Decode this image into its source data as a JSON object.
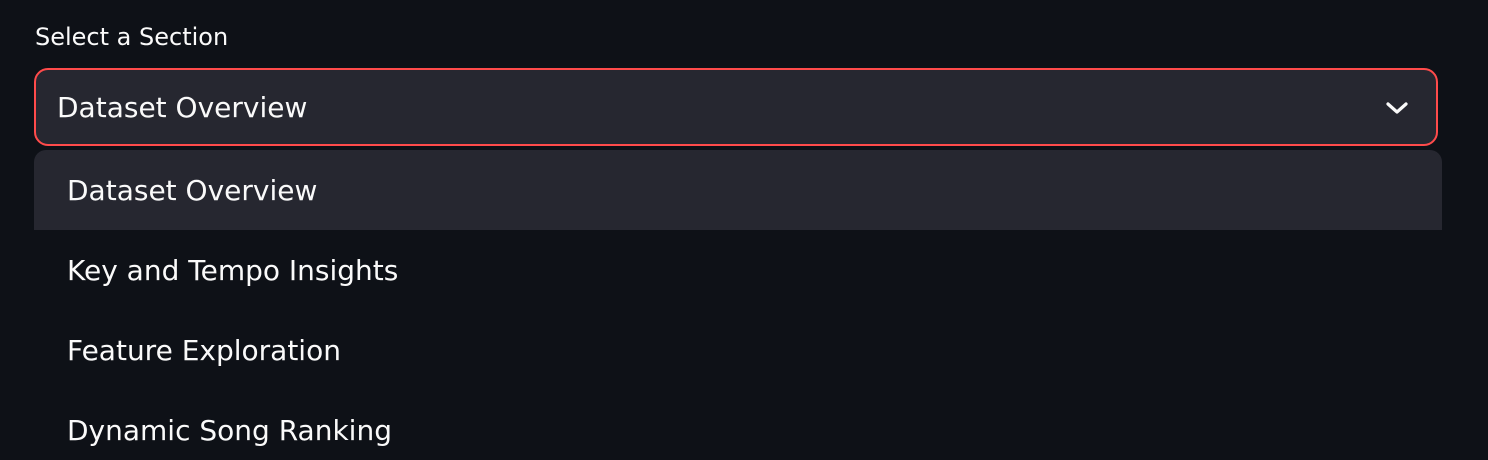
{
  "select": {
    "label": "Select a Section",
    "value": "Dataset Overview",
    "accent_color": "#ff4b4b",
    "chevron_icon": "chevron-down-icon"
  },
  "options": [
    {
      "label": "Dataset Overview",
      "active": true
    },
    {
      "label": "Key and Tempo Insights",
      "active": false
    },
    {
      "label": "Feature Exploration",
      "active": false
    },
    {
      "label": "Dynamic Song Ranking",
      "active": false
    }
  ]
}
